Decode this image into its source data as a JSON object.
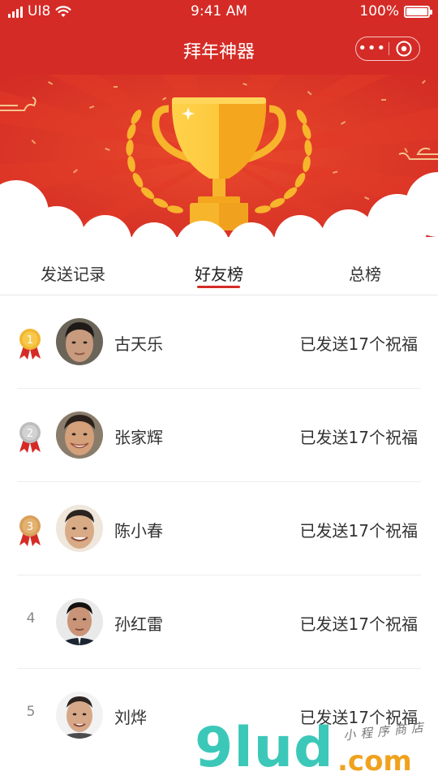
{
  "status_bar": {
    "carrier": "UI8",
    "time": "9:41 AM",
    "battery_text": "100%",
    "battery_level": 1.0
  },
  "nav": {
    "title": "拜年神器",
    "more_icon": "more-dots-icon",
    "close_icon": "target-close-icon"
  },
  "banner": {
    "icon": "trophy-icon",
    "colors": {
      "background": "#d52b26",
      "trophy": "#f7b52c",
      "cloud": "#ffffff"
    }
  },
  "tabs": [
    {
      "label": "发送记录",
      "active": false
    },
    {
      "label": "好友榜",
      "active": true
    },
    {
      "label": "总榜",
      "active": false
    }
  ],
  "ranking": [
    {
      "rank": "1",
      "medal": "gold",
      "name": "古天乐",
      "sent_text": "已发送17个祝福"
    },
    {
      "rank": "2",
      "medal": "silver",
      "name": "张家辉",
      "sent_text": "已发送17个祝福"
    },
    {
      "rank": "3",
      "medal": "bronze",
      "name": "陈小春",
      "sent_text": "已发送17个祝福"
    },
    {
      "rank": "4",
      "medal": "",
      "name": "孙红雷",
      "sent_text": "已发送17个祝福"
    },
    {
      "rank": "5",
      "medal": "",
      "name": "刘烨",
      "sent_text": "已发送17个祝福"
    }
  ],
  "watermark": {
    "brand": "9lud",
    "tld": ".com",
    "subtitle": "小程序商店"
  }
}
